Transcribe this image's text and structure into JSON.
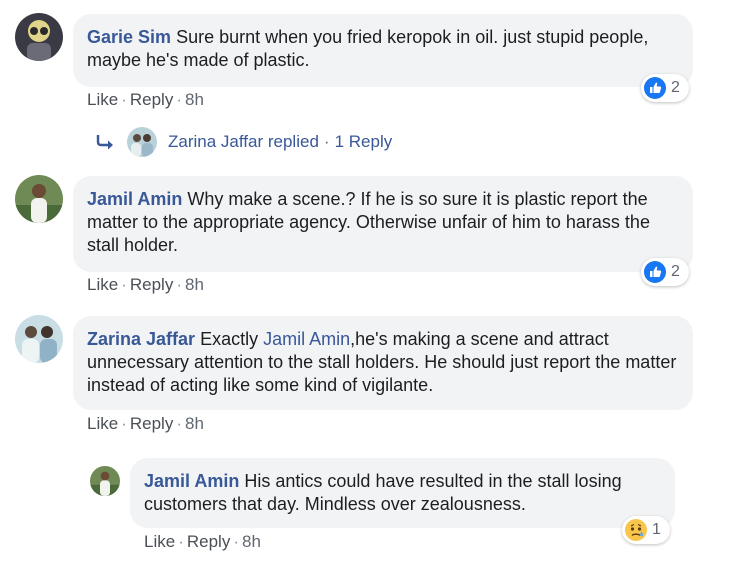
{
  "comments": [
    {
      "author": "Garie Sim",
      "text": "Sure burnt when you fried keropok in oil. just stupid people, maybe he's made of plastic.",
      "actions": {
        "like": "Like",
        "reply": "Reply",
        "time": "8h"
      },
      "reaction": {
        "type": "like",
        "count": "2"
      }
    },
    {
      "author": "Jamil Amin",
      "text": "Why make a scene.? If he is so sure it is plastic report the matter to the appropriate agency. Otherwise unfair of him to harass the stall holder.",
      "actions": {
        "like": "Like",
        "reply": "Reply",
        "time": "8h"
      },
      "reaction": {
        "type": "like",
        "count": "2"
      }
    },
    {
      "author": "Zarina Jaffar",
      "text_before": "Exactly ",
      "mention": "Jamil Amin",
      "text_after": ",he's making a scene and attract unnecessary attention to the stall holders. He should just report the matter instead of acting like some kind of vigilante.",
      "actions": {
        "like": "Like",
        "reply": "Reply",
        "time": "8h"
      }
    },
    {
      "author": "Jamil Amin",
      "text": "His antics could have resulted in the stall losing customers that day. Mindless over zealousness.",
      "actions": {
        "like": "Like",
        "reply": "Reply",
        "time": "8h"
      },
      "reaction": {
        "type": "sad",
        "count": "1"
      }
    }
  ],
  "reply_summary": {
    "replier": "Zarina Jaffar",
    "replied_text": "replied",
    "count_text": "1 Reply"
  },
  "colors": {
    "name_link": "#385898",
    "bubble_bg": "#f2f3f5",
    "meta_text": "#606770",
    "like_blue": "#1877f2"
  }
}
